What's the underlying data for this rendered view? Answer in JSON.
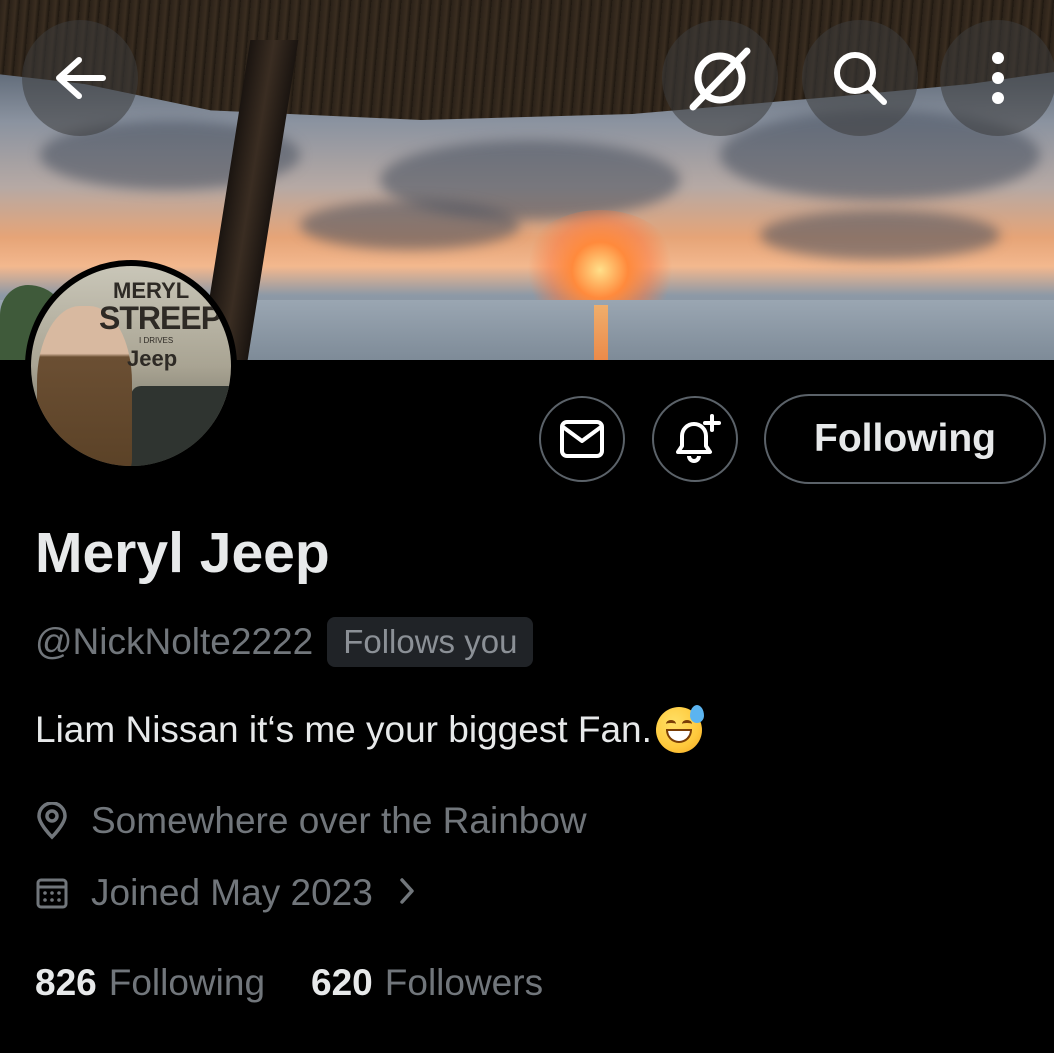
{
  "header": {
    "back_icon": "arrow-left-icon",
    "grok_icon": "grok-icon",
    "search_icon": "search-icon",
    "more_icon": "more-vertical-icon"
  },
  "avatar": {
    "lines": [
      "MERYL",
      "STREEP",
      "I DRIVES",
      "Jeep"
    ]
  },
  "actions": {
    "message_icon": "envelope-icon",
    "notify_icon": "bell-plus-icon",
    "follow_label": "Following"
  },
  "profile": {
    "display_name": "Meryl Jeep",
    "handle": "@NickNolte2222",
    "follows_you": "Follows you",
    "bio": "Liam Nissan it‘s me your biggest Fan.",
    "location": "Somewhere over the Rainbow",
    "joined": "Joined May 2023"
  },
  "stats": {
    "following_count": "826",
    "following_label": "Following",
    "followers_count": "620",
    "followers_label": "Followers"
  }
}
